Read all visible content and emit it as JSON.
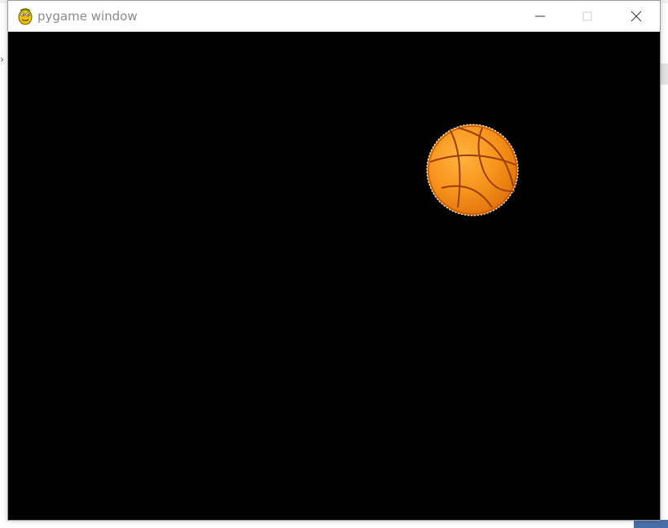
{
  "window": {
    "title": "pygame window",
    "app_icon": "pygame-snake-icon",
    "controls": {
      "minimize_icon": "minimize-icon",
      "maximize_icon": "maximize-icon",
      "close_icon": "close-icon"
    }
  },
  "canvas": {
    "background": "#000000",
    "sprite": "basketball",
    "sprite_color": "#f7941d"
  }
}
